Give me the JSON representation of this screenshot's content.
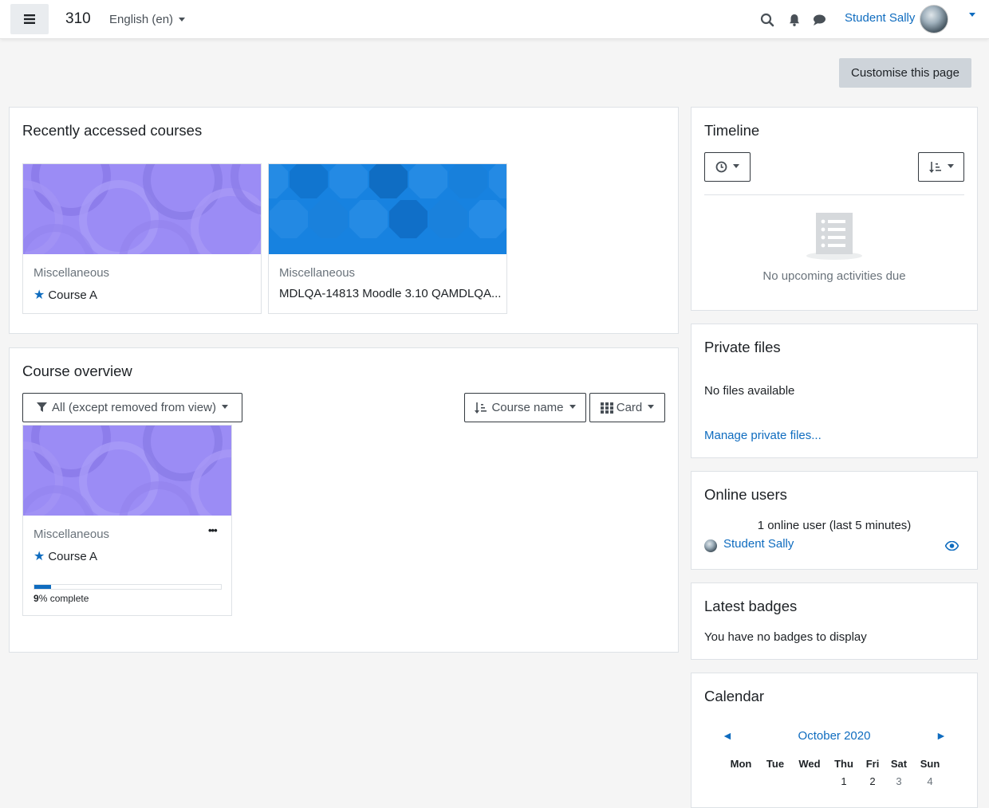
{
  "navbar": {
    "site_name": "310",
    "language": "English (en)",
    "user_name": "Student Sally"
  },
  "header": {
    "customise_label": "Customise this page"
  },
  "recent": {
    "title": "Recently accessed courses",
    "courses": [
      {
        "category": "Miscellaneous",
        "name": "Course A",
        "starred": true
      },
      {
        "category": "Miscellaneous",
        "name": "MDLQA-14813 Moodle 3.10 QAMDLQA...",
        "starred": false
      }
    ]
  },
  "overview": {
    "title": "Course overview",
    "filter_label": "All (except removed from view)",
    "sort_label": "Course name",
    "view_label": "Card",
    "courses": [
      {
        "category": "Miscellaneous",
        "name": "Course A",
        "starred": true,
        "progress_pct": "9",
        "progress_value": 0.09,
        "progress_suffix": "% complete",
        "menu_glyph": "•••"
      }
    ]
  },
  "timeline": {
    "title": "Timeline",
    "empty_text": "No upcoming activities due"
  },
  "private_files": {
    "title": "Private files",
    "empty_text": "No files available",
    "manage_link": "Manage private files..."
  },
  "online_users": {
    "title": "Online users",
    "summary": "1 online user (last 5 minutes)",
    "users": [
      {
        "name": "Student Sally"
      }
    ]
  },
  "badges": {
    "title": "Latest badges",
    "empty_text": "You have no badges to display"
  },
  "calendar": {
    "title": "Calendar",
    "month": "October 2020",
    "prev_glyph": "◄",
    "next_glyph": "►",
    "weekdays": [
      "Mon",
      "Tue",
      "Wed",
      "Thu",
      "Fri",
      "Sat",
      "Sun"
    ],
    "first_week": [
      "",
      "",
      "",
      "1",
      "2",
      "3",
      "4"
    ]
  },
  "colors": {
    "accent": "#0f6cbf",
    "course_a_bg": "#9b8cf5",
    "course_b_bg": "#1782e0"
  },
  "icons": {
    "nav_toggle": "hamburger-icon",
    "search": "search-icon",
    "notifications": "bell-icon",
    "messages": "chat-bubble-icon",
    "favourite": "star-icon",
    "filter": "filter-icon",
    "sort": "sort-icon",
    "view": "grid-icon",
    "timeline_date": "clock-icon",
    "timeline_sort": "sort-icon",
    "empty_state": "list-document-icon",
    "online_toggle": "eye-icon"
  }
}
